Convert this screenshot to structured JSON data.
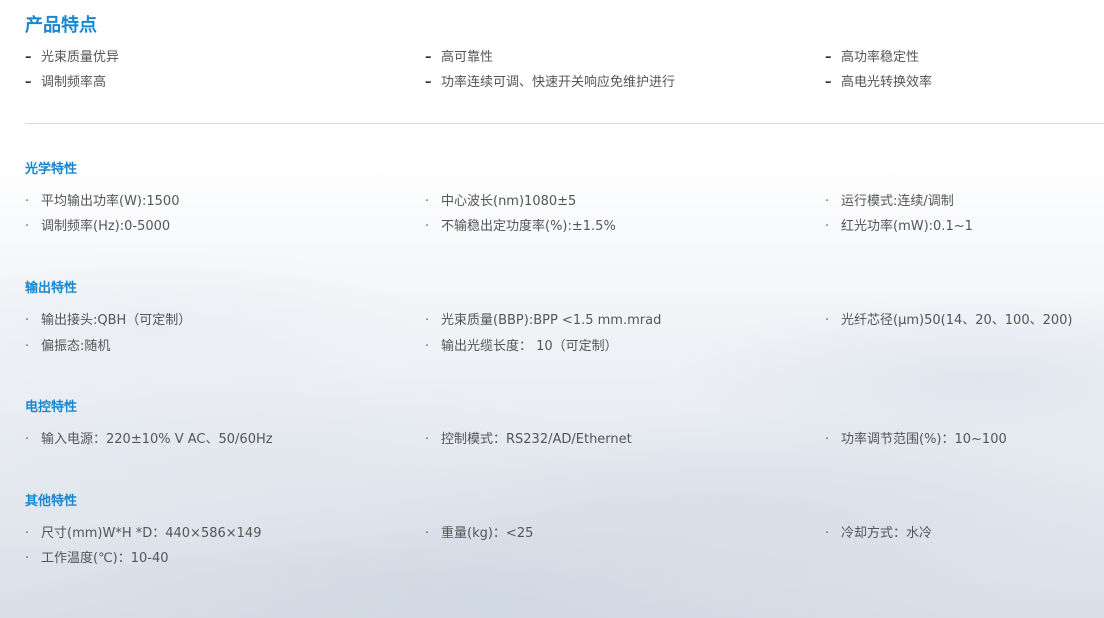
{
  "product_features": {
    "title": "产品特点",
    "marker": "–",
    "rows": [
      [
        "光束质量优异",
        "高可靠性",
        "高功率稳定性"
      ],
      [
        "调制频率高",
        "功率连续可调、快速开关响应免维护进行",
        "高电光转换效率"
      ]
    ]
  },
  "bullet_char": "·",
  "sections": [
    {
      "title": "光学特性",
      "rows": [
        [
          "平均输出功率(W):1500",
          "中心波长(nm)1080±5",
          "运行模式:连续/调制"
        ],
        [
          "调制频率(Hz):0-5000",
          "不输稳出定功度率(%):±1.5%",
          "红光功率(mW):0.1~1"
        ]
      ]
    },
    {
      "title": "输出特性",
      "rows": [
        [
          "输出接头:QBH（可定制）",
          "光束质量(BBP):BPP <1.5 mm.mrad",
          "光纤芯径(μm)50(14、20、100、200)"
        ],
        [
          "偏振态:随机",
          "输出光缆长度： 10（可定制）",
          ""
        ]
      ]
    },
    {
      "title": "电控特性",
      "rows": [
        [
          "输入电源：220±10% V AC、50/60Hz",
          "控制模式：RS232/AD/Ethernet",
          "功率调节范围(%)：10~100"
        ]
      ]
    },
    {
      "title": "其他特性",
      "rows": [
        [
          "尺寸(mm)W*H *D：440×586×149",
          "重量(kg)：<25",
          "冷却方式：水冷"
        ],
        [
          "工作温度(℃)：10-40",
          "",
          ""
        ]
      ]
    }
  ]
}
